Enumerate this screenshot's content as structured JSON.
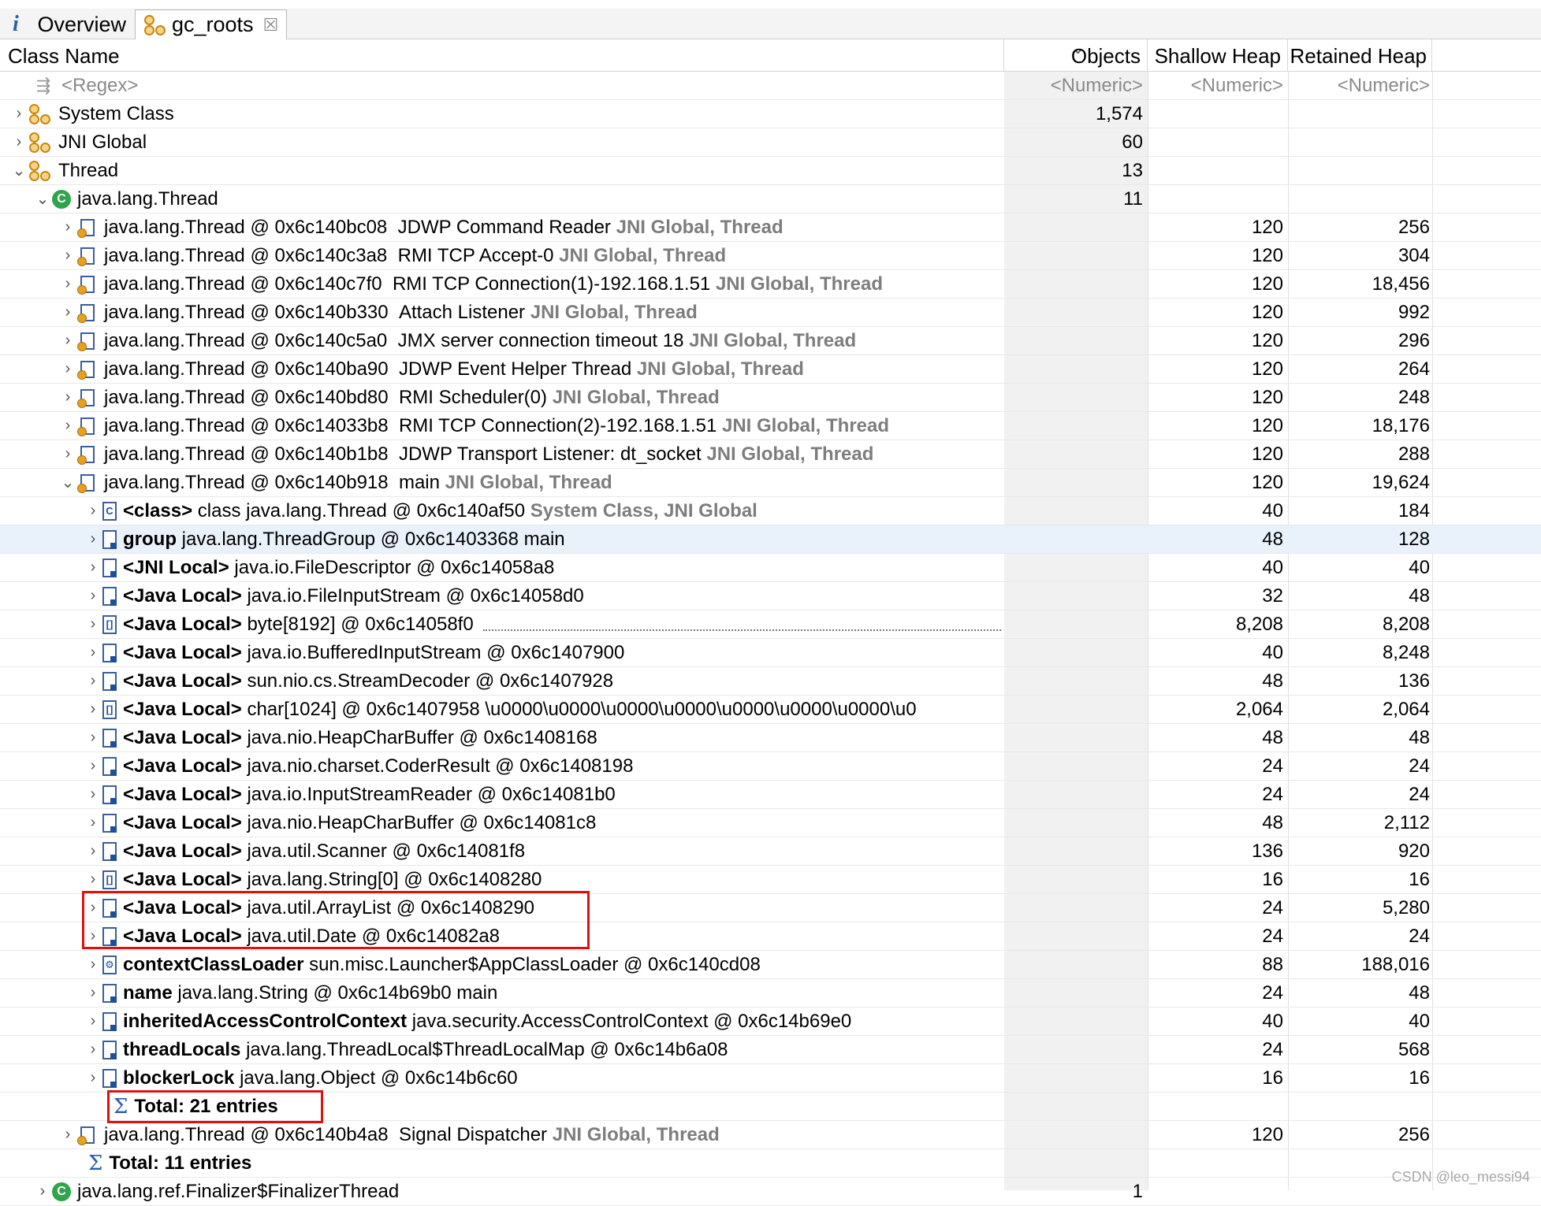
{
  "tabs": [
    {
      "label": "Overview",
      "icon": "info-icon"
    },
    {
      "label": "gc_roots",
      "icon": "gc-roots-icon",
      "close": "☒"
    }
  ],
  "columns": {
    "name": "Class Name",
    "objects": "Objects",
    "shallow": "Shallow Heap",
    "retained": "Retained Heap"
  },
  "filters": {
    "name": "<Regex>",
    "objects": "<Numeric>",
    "shallow": "<Numeric>",
    "retained": "<Numeric>"
  },
  "roots": [
    {
      "label": "System Class",
      "objects": "1,574"
    },
    {
      "label": "JNI Global",
      "objects": "60"
    },
    {
      "label": "Thread",
      "objects": "13"
    }
  ],
  "thread_class": {
    "label": "java.lang.Thread",
    "objects": "11"
  },
  "threads": [
    {
      "ref": "java.lang.Thread @ 0x6c140bc08",
      "name": "JDWP Command Reader",
      "roots": "JNI Global, Thread",
      "shallow": "120",
      "retained": "256"
    },
    {
      "ref": "java.lang.Thread @ 0x6c140c3a8",
      "name": "RMI TCP Accept-0",
      "roots": "JNI Global, Thread",
      "shallow": "120",
      "retained": "304"
    },
    {
      "ref": "java.lang.Thread @ 0x6c140c7f0",
      "name": "RMI TCP Connection(1)-192.168.1.51",
      "roots": "JNI Global, Thread",
      "shallow": "120",
      "retained": "18,456"
    },
    {
      "ref": "java.lang.Thread @ 0x6c140b330",
      "name": "Attach Listener",
      "roots": "JNI Global, Thread",
      "shallow": "120",
      "retained": "992"
    },
    {
      "ref": "java.lang.Thread @ 0x6c140c5a0",
      "name": "JMX server connection timeout 18",
      "roots": "JNI Global, Thread",
      "shallow": "120",
      "retained": "296"
    },
    {
      "ref": "java.lang.Thread @ 0x6c140ba90",
      "name": "JDWP Event Helper Thread",
      "roots": "JNI Global, Thread",
      "shallow": "120",
      "retained": "264"
    },
    {
      "ref": "java.lang.Thread @ 0x6c140bd80",
      "name": "RMI Scheduler(0)",
      "roots": "JNI Global, Thread",
      "shallow": "120",
      "retained": "248"
    },
    {
      "ref": "java.lang.Thread @ 0x6c14033b8",
      "name": "RMI TCP Connection(2)-192.168.1.51",
      "roots": "JNI Global, Thread",
      "shallow": "120",
      "retained": "18,176"
    },
    {
      "ref": "java.lang.Thread @ 0x6c140b1b8",
      "name": "JDWP Transport Listener: dt_socket",
      "roots": "JNI Global, Thread",
      "shallow": "120",
      "retained": "288"
    }
  ],
  "main_thread": {
    "ref": "java.lang.Thread @ 0x6c140b918",
    "name": "main",
    "roots": "JNI Global, Thread",
    "shallow": "120",
    "retained": "19,624"
  },
  "children": [
    {
      "field": "<class>",
      "text": "class java.lang.Thread @ 0x6c140af50",
      "extra": "System Class, JNI Global",
      "shallow": "40",
      "retained": "184",
      "icon": "class-object-icon"
    },
    {
      "field": "group",
      "text": "java.lang.ThreadGroup @ 0x6c1403368  main",
      "extra": "",
      "shallow": "48",
      "retained": "128",
      "icon": "object-icon"
    },
    {
      "field": "<JNI Local>",
      "text": "java.io.FileDescriptor @ 0x6c14058a8",
      "extra": "",
      "shallow": "40",
      "retained": "40",
      "icon": "object-icon"
    },
    {
      "field": "<Java Local>",
      "text": "java.io.FileInputStream @ 0x6c14058d0",
      "extra": "",
      "shallow": "32",
      "retained": "48",
      "icon": "object-icon"
    },
    {
      "field": "<Java Local>",
      "text": "byte[8192] @ 0x6c14058f0",
      "extra": "",
      "shallow": "8,208",
      "retained": "8,208",
      "icon": "array-icon"
    },
    {
      "field": "<Java Local>",
      "text": "java.io.BufferedInputStream @ 0x6c1407900",
      "extra": "",
      "shallow": "40",
      "retained": "8,248",
      "icon": "object-icon"
    },
    {
      "field": "<Java Local>",
      "text": "sun.nio.cs.StreamDecoder @ 0x6c1407928",
      "extra": "",
      "shallow": "48",
      "retained": "136",
      "icon": "object-icon"
    },
    {
      "field": "<Java Local>",
      "text": "char[1024] @ 0x6c1407958  \\u0000\\u0000\\u0000\\u0000\\u0000\\u0000\\u0000\\u0",
      "extra": "",
      "shallow": "2,064",
      "retained": "2,064",
      "icon": "array-icon"
    },
    {
      "field": "<Java Local>",
      "text": "java.nio.HeapCharBuffer @ 0x6c1408168",
      "extra": "",
      "shallow": "48",
      "retained": "48",
      "icon": "object-icon"
    },
    {
      "field": "<Java Local>",
      "text": "java.nio.charset.CoderResult @ 0x6c1408198",
      "extra": "",
      "shallow": "24",
      "retained": "24",
      "icon": "object-icon"
    },
    {
      "field": "<Java Local>",
      "text": "java.io.InputStreamReader @ 0x6c14081b0",
      "extra": "",
      "shallow": "24",
      "retained": "24",
      "icon": "object-icon"
    },
    {
      "field": "<Java Local>",
      "text": "java.nio.HeapCharBuffer @ 0x6c14081c8",
      "extra": "",
      "shallow": "48",
      "retained": "2,112",
      "icon": "object-icon"
    },
    {
      "field": "<Java Local>",
      "text": "java.util.Scanner @ 0x6c14081f8",
      "extra": "",
      "shallow": "136",
      "retained": "920",
      "icon": "object-icon"
    },
    {
      "field": "<Java Local>",
      "text": "java.lang.String[0] @ 0x6c1408280",
      "extra": "",
      "shallow": "16",
      "retained": "16",
      "icon": "array-icon"
    },
    {
      "field": "<Java Local>",
      "text": "java.util.ArrayList @ 0x6c1408290",
      "extra": "",
      "shallow": "24",
      "retained": "5,280",
      "icon": "object-icon"
    },
    {
      "field": "<Java Local>",
      "text": "java.util.Date @ 0x6c14082a8",
      "extra": "",
      "shallow": "24",
      "retained": "24",
      "icon": "object-icon"
    },
    {
      "field": "contextClassLoader",
      "text": "sun.misc.Launcher$AppClassLoader @ 0x6c140cd08",
      "extra": "",
      "shallow": "88",
      "retained": "188,016",
      "icon": "classloader-icon"
    },
    {
      "field": "name",
      "text": "java.lang.String @ 0x6c14b69b0  main",
      "extra": "",
      "shallow": "24",
      "retained": "48",
      "icon": "object-icon"
    },
    {
      "field": "inheritedAccessControlContext",
      "text": "java.security.AccessControlContext @ 0x6c14b69e0",
      "extra": "",
      "shallow": "40",
      "retained": "40",
      "icon": "object-icon"
    },
    {
      "field": "threadLocals",
      "text": "java.lang.ThreadLocal$ThreadLocalMap @ 0x6c14b6a08",
      "extra": "",
      "shallow": "24",
      "retained": "568",
      "icon": "object-icon"
    },
    {
      "field": "blockerLock",
      "text": "java.lang.Object @ 0x6c14b6c60",
      "extra": "",
      "shallow": "16",
      "retained": "16",
      "icon": "object-icon"
    }
  ],
  "children_total": "Total: 21 entries",
  "signal_thread": {
    "ref": "java.lang.Thread @ 0x6c140b4a8",
    "name": "Signal Dispatcher",
    "roots": "JNI Global, Thread",
    "shallow": "120",
    "retained": "256"
  },
  "threads_total": "Total: 11 entries",
  "finalizer": {
    "label": "java.lang.ref.Finalizer$FinalizerThread",
    "objects": "1"
  },
  "watermark": "CSDN @leo_messi94"
}
